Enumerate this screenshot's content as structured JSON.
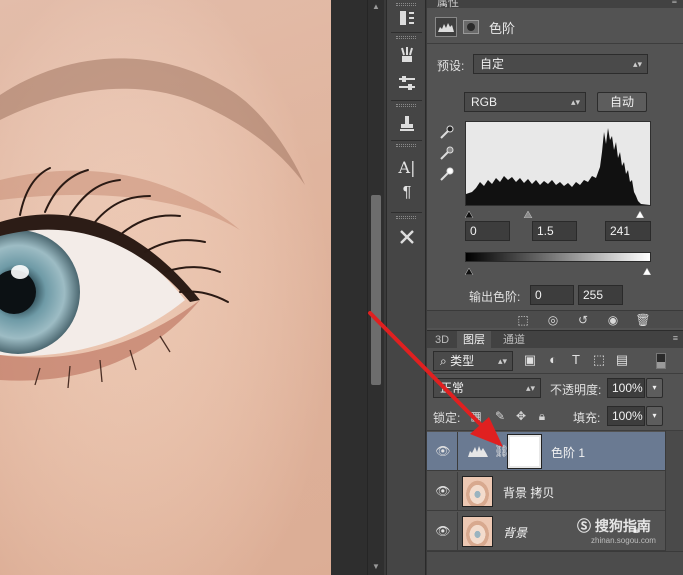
{
  "properties": {
    "panel_title": "属性",
    "adjustment_name": "色阶",
    "preset_label": "预设:",
    "preset_value": "自定",
    "channel_value": "RGB",
    "auto_button": "自动",
    "input_black": "0",
    "input_gamma": "1.5",
    "input_white": "241",
    "output_label": "输出色阶:",
    "output_black": "0",
    "output_white": "255"
  },
  "layers_panel": {
    "tabs": [
      "3D",
      "图层",
      "通道"
    ],
    "active_tab": 1,
    "filter_label": "类型",
    "blend_mode": "正常",
    "opacity_label": "不透明度:",
    "opacity_value": "100%",
    "lock_label": "锁定:",
    "fill_label": "填充:",
    "fill_value": "100%",
    "layers": [
      {
        "name": "色阶 1",
        "type": "adjustment",
        "selected": true
      },
      {
        "name": "背景 拷贝",
        "type": "photo",
        "selected": false
      },
      {
        "name": "背景",
        "type": "photo",
        "selected": false
      }
    ]
  },
  "watermark": {
    "brand": "搜狗指南",
    "url": "zhinan.sogou.com"
  },
  "icons": {
    "tools": [
      "history-icon",
      "brush-preset-icon",
      "adjust-icon",
      "stamp-icon",
      "character-icon",
      "paragraph-icon",
      "tool-preset-icon"
    ],
    "eyedroppers": [
      "eyedropper-black-icon",
      "eyedropper-gray-icon",
      "eyedropper-white-icon"
    ]
  },
  "colors": {
    "selected_layer": "#6a7a92",
    "panel_bg": "#535353",
    "annotation_arrow": "#e02020"
  }
}
